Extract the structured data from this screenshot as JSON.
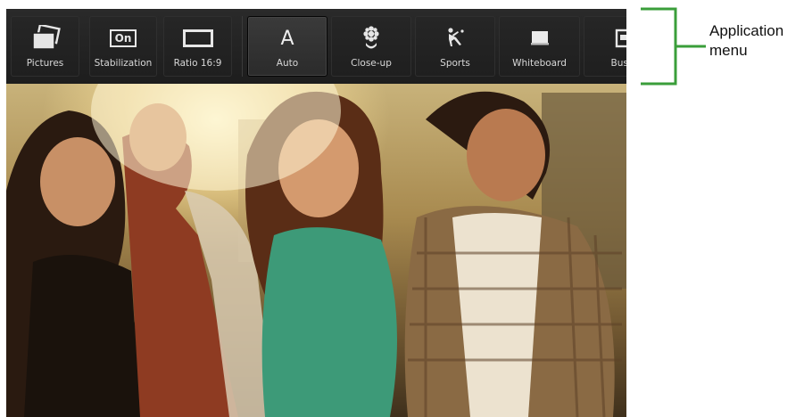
{
  "menu": {
    "items": [
      {
        "id": "pictures",
        "label": "Pictures",
        "icon": "pictures-icon",
        "selected": false
      },
      {
        "id": "stabilization",
        "label": "Stabilization",
        "icon": "stabilization-on-icon",
        "icon_text": "On",
        "selected": false
      },
      {
        "id": "ratio",
        "label": "Ratio 16:9",
        "icon": "ratio-16-9-icon",
        "selected": false
      },
      {
        "id": "auto",
        "label": "Auto",
        "icon": "auto-icon",
        "icon_text": "A",
        "selected": true
      },
      {
        "id": "closeup",
        "label": "Close-up",
        "icon": "close-up-icon",
        "selected": false
      },
      {
        "id": "sports",
        "label": "Sports",
        "icon": "sports-icon",
        "selected": false
      },
      {
        "id": "whiteboard",
        "label": "Whiteboard",
        "icon": "whiteboard-icon",
        "selected": false
      },
      {
        "id": "business",
        "label": "Busin",
        "icon": "business-card-icon",
        "selected": false
      }
    ]
  },
  "annotation": {
    "text_line1": "Application",
    "text_line2": "menu",
    "bracket_color": "#3a9e3a"
  },
  "colors": {
    "menu_bg": "#222222",
    "label": "#d8d8d8",
    "selected_bg": "#333333"
  }
}
